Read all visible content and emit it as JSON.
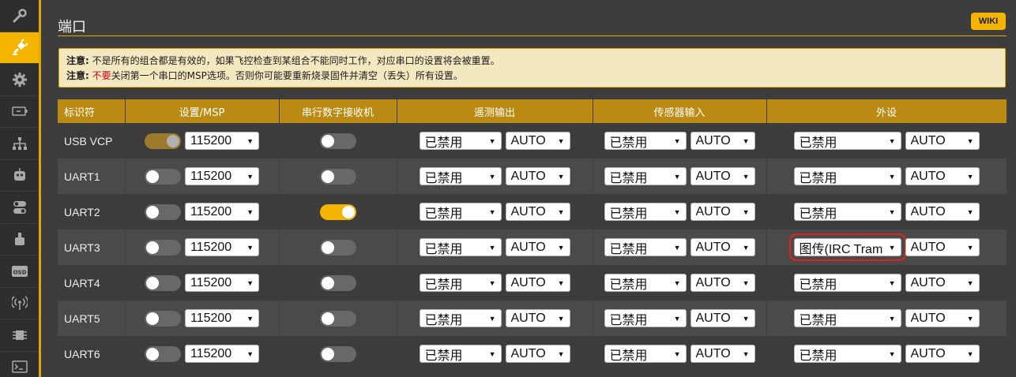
{
  "page": {
    "title": "端口",
    "wiki_label": "WIKI"
  },
  "notice": {
    "line1_label": "注意:",
    "line1_text": "不是所有的组合都是有效的，如果飞控检查到某组合不能同时工作，对应串口的设置将会被重置。",
    "line2_label": "注意:",
    "line2_warn": "不要",
    "line2_text": "关闭第一个串口的MSP选项。否则你可能要重新烧录固件并清空（丢失）所有设置。"
  },
  "sidebar": {
    "items": [
      {
        "icon": "wrench-icon",
        "active": false
      },
      {
        "icon": "plug-icon",
        "active": true
      },
      {
        "icon": "gear-icon",
        "active": false
      },
      {
        "icon": "battery-icon",
        "active": false
      },
      {
        "icon": "network-icon",
        "active": false
      },
      {
        "icon": "robot-icon",
        "active": false
      },
      {
        "icon": "switches-icon",
        "active": false
      },
      {
        "icon": "motor-icon",
        "active": false
      },
      {
        "icon": "osd-icon",
        "active": false
      },
      {
        "icon": "antenna-icon",
        "active": false
      },
      {
        "icon": "chip-icon",
        "active": false
      },
      {
        "icon": "terminal-icon",
        "active": false
      }
    ],
    "osd_label": "OSD"
  },
  "table": {
    "headers": [
      "标识符",
      "设置/MSP",
      "串行数字接收机",
      "遥测输出",
      "传感器输入",
      "外设"
    ],
    "rows": [
      {
        "id": "USB VCP",
        "msp": "dim",
        "baud": "115200",
        "rx": false,
        "telemetry": "已禁用",
        "telemetry_baud": "AUTO",
        "sensor": "已禁用",
        "sensor_baud": "AUTO",
        "peripheral": "已禁用",
        "peripheral_baud": "AUTO"
      },
      {
        "id": "UART1",
        "msp": "off",
        "baud": "115200",
        "rx": false,
        "telemetry": "已禁用",
        "telemetry_baud": "AUTO",
        "sensor": "已禁用",
        "sensor_baud": "AUTO",
        "peripheral": "已禁用",
        "peripheral_baud": "AUTO"
      },
      {
        "id": "UART2",
        "msp": "off",
        "baud": "115200",
        "rx": true,
        "telemetry": "已禁用",
        "telemetry_baud": "AUTO",
        "sensor": "已禁用",
        "sensor_baud": "AUTO",
        "peripheral": "已禁用",
        "peripheral_baud": "AUTO"
      },
      {
        "id": "UART3",
        "msp": "off",
        "baud": "115200",
        "rx": false,
        "telemetry": "已禁用",
        "telemetry_baud": "AUTO",
        "sensor": "已禁用",
        "sensor_baud": "AUTO",
        "peripheral": "图传(IRC Tram",
        "peripheral_baud": "AUTO",
        "highlight": true
      },
      {
        "id": "UART4",
        "msp": "off",
        "baud": "115200",
        "rx": false,
        "telemetry": "已禁用",
        "telemetry_baud": "AUTO",
        "sensor": "已禁用",
        "sensor_baud": "AUTO",
        "peripheral": "已禁用",
        "peripheral_baud": "AUTO"
      },
      {
        "id": "UART5",
        "msp": "off",
        "baud": "115200",
        "rx": false,
        "telemetry": "已禁用",
        "telemetry_baud": "AUTO",
        "sensor": "已禁用",
        "sensor_baud": "AUTO",
        "peripheral": "已禁用",
        "peripheral_baud": "AUTO"
      },
      {
        "id": "UART6",
        "msp": "off",
        "baud": "115200",
        "rx": false,
        "telemetry": "已禁用",
        "telemetry_baud": "AUTO",
        "sensor": "已禁用",
        "sensor_baud": "AUTO",
        "peripheral": "已禁用",
        "peripheral_baud": "AUTO"
      }
    ]
  },
  "colors": {
    "accent": "#f4b400",
    "header": "#bb8a12",
    "highlight_border": "#e4201b",
    "warning_text": "#d0021b"
  }
}
